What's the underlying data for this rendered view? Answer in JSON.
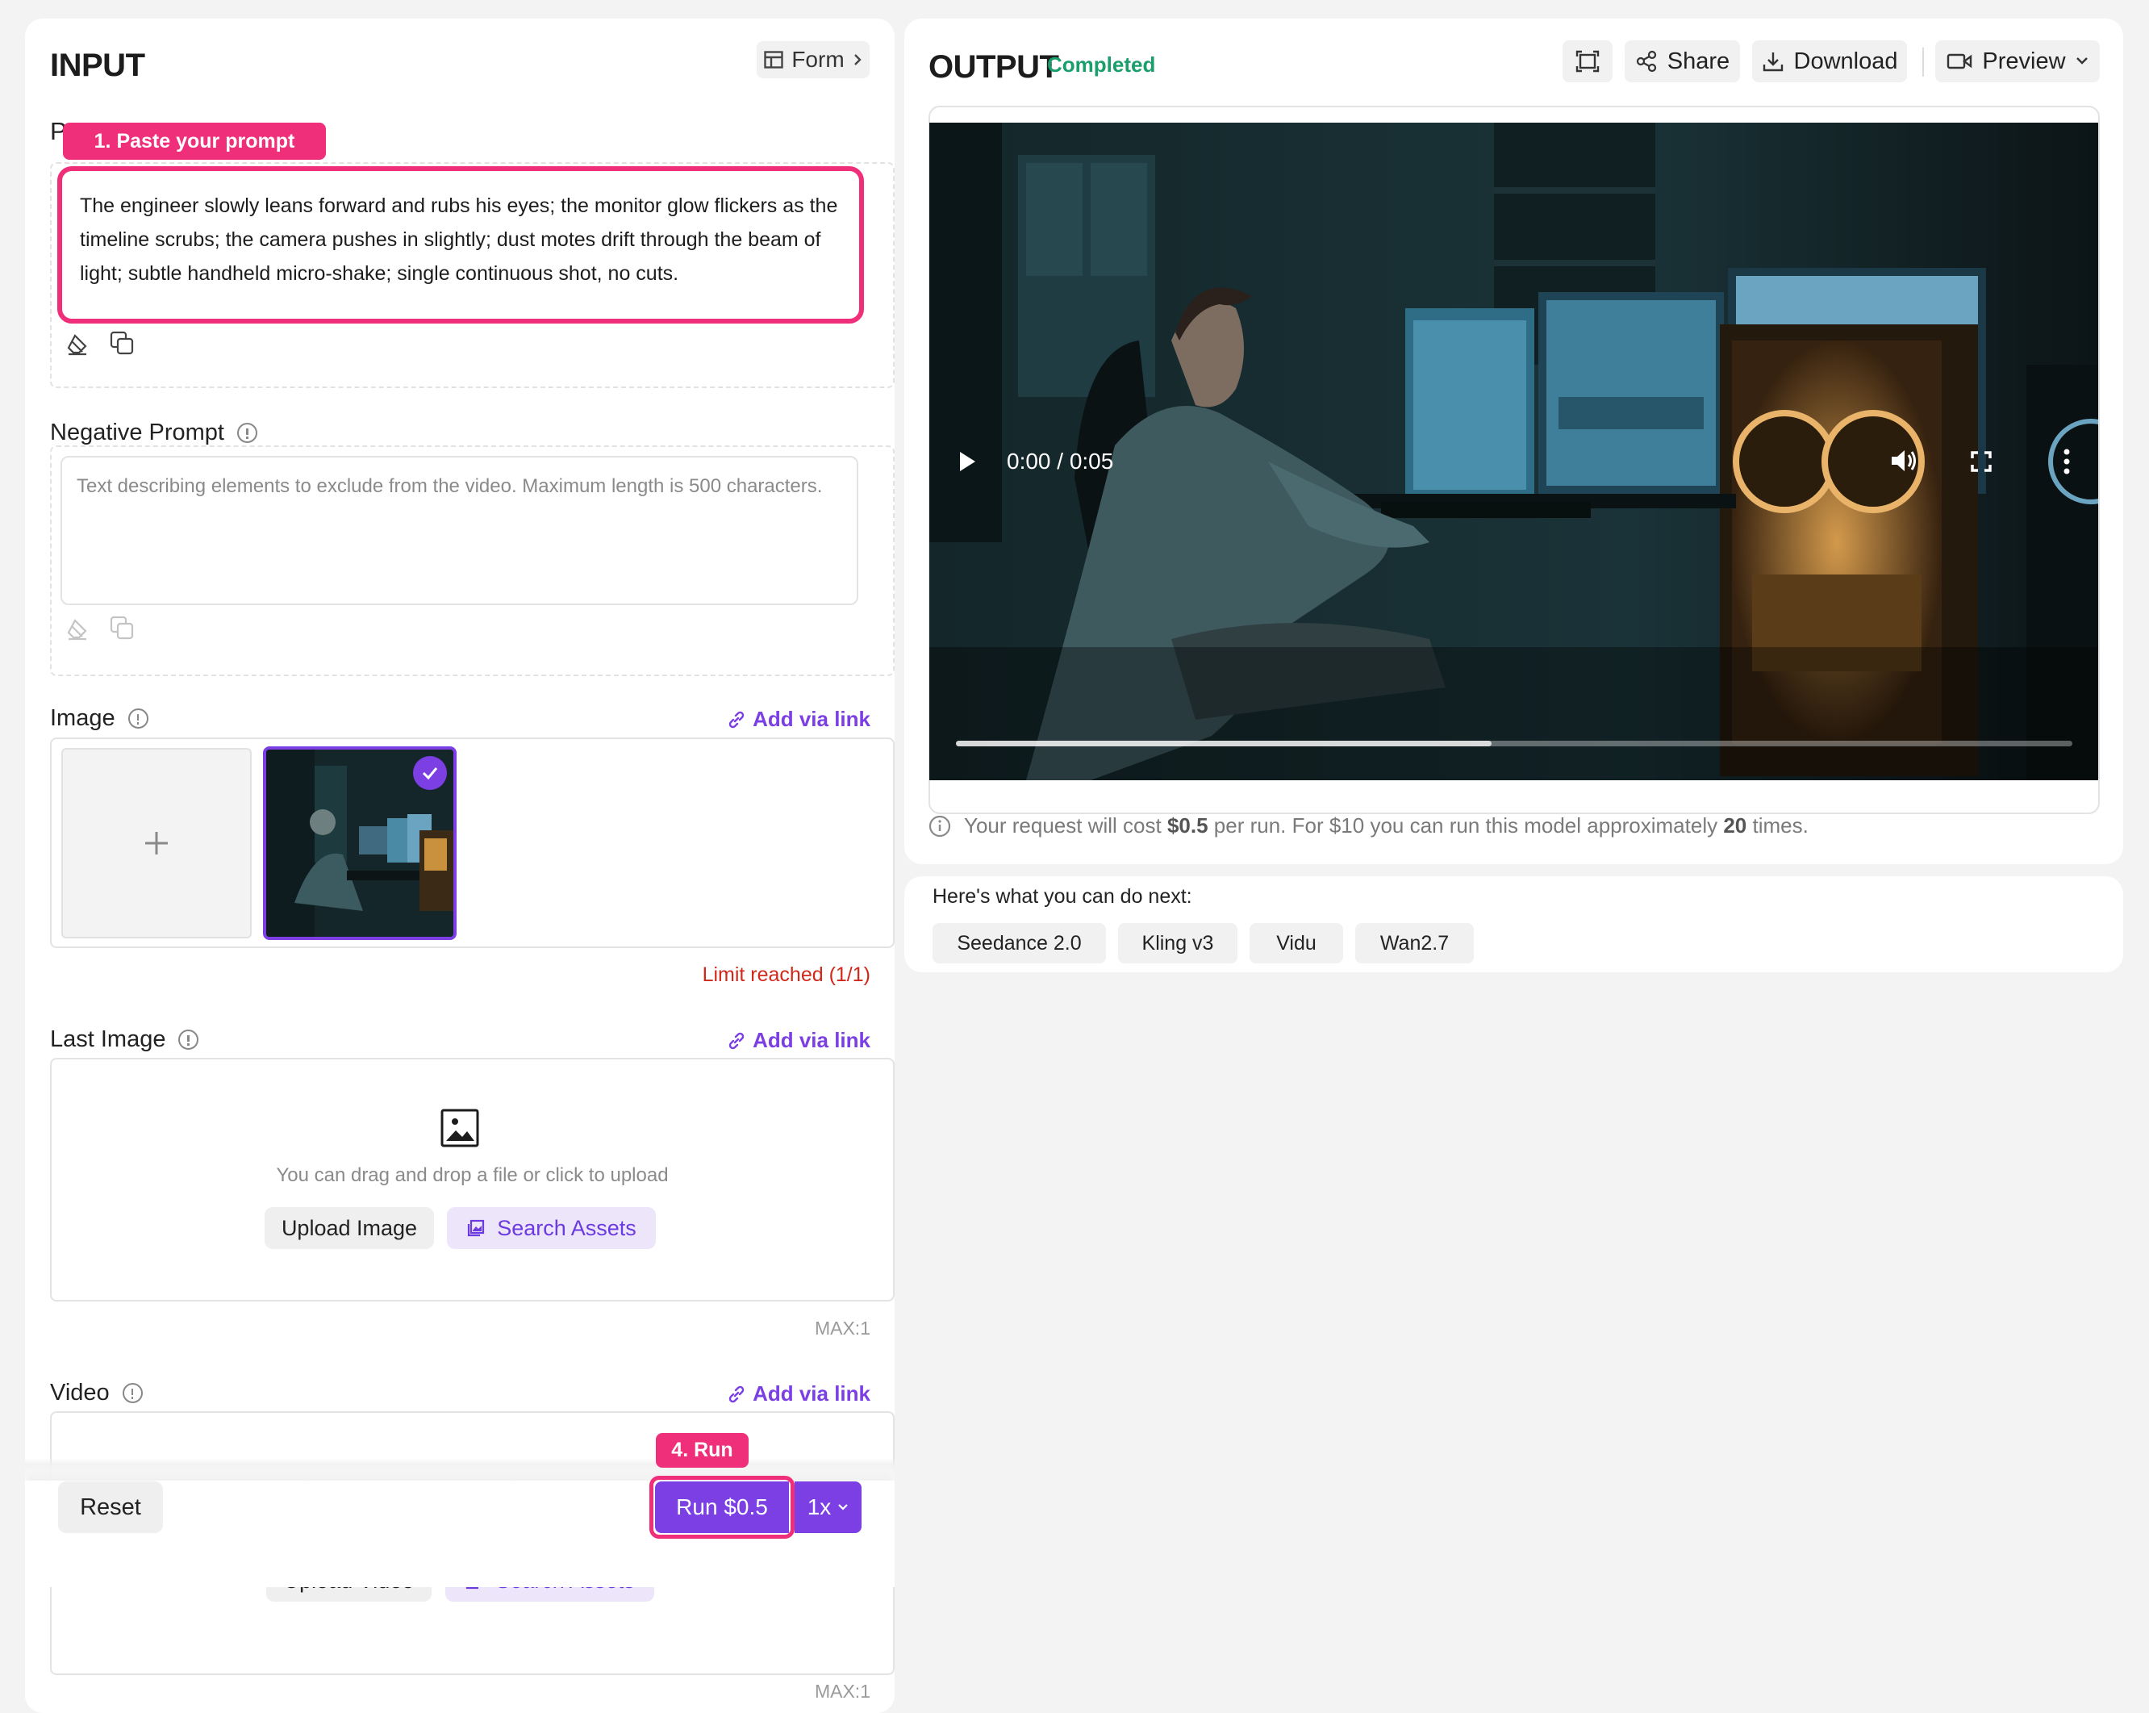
{
  "input": {
    "title": "INPUT",
    "form_toggle": "Form",
    "prompt": {
      "label": "P",
      "annotation": "1. Paste your prompt",
      "value": "The engineer slowly leans forward and rubs his eyes; the monitor glow flickers as the timeline scrubs; the camera pushes in slightly; dust motes drift through the beam of light; subtle handheld micro-shake; single continuous shot, no cuts."
    },
    "negative_prompt": {
      "label": "Negative Prompt",
      "placeholder": "Text describing elements to exclude from the video. Maximum length is 500 characters."
    },
    "image": {
      "label": "Image",
      "add_link": "Add via link",
      "limit_text": "Limit reached (1/1)"
    },
    "last_image": {
      "label": "Last Image",
      "add_link": "Add via link",
      "drop_text": "You can drag and drop a file or click to upload",
      "upload_label": "Upload Image",
      "search_label": "Search Assets",
      "max_text": "MAX:1"
    },
    "video": {
      "label": "Video",
      "add_link": "Add via link",
      "upload_label": "Upload Video",
      "search_label": "Search Assets",
      "max_text": "MAX:1"
    },
    "footer": {
      "reset_label": "Reset",
      "run_annotation": "4. Run",
      "run_label": "Run $0.5",
      "multiplier": "1x"
    }
  },
  "output": {
    "title": "OUTPUT",
    "status": "Completed",
    "share_label": "Share",
    "download_label": "Download",
    "preview_label": "Preview",
    "video_time": "0:00 / 0:05",
    "video_progress": 0.48,
    "cost_prefix": "Your request will cost ",
    "cost_amount": "$0.5",
    "cost_middle": " per run. For $10 you can run this model approximately ",
    "cost_count": "20",
    "cost_suffix": " times."
  },
  "next": {
    "heading": "Here's what you can do next:",
    "models": [
      "Seedance 2.0",
      "Kling v3",
      "Vidu",
      "Wan2.7"
    ]
  },
  "colors": {
    "accent": "#7b3fe4",
    "status": "#1a9e6b",
    "annotation": "#ef2f7a",
    "error": "#d0281a"
  }
}
